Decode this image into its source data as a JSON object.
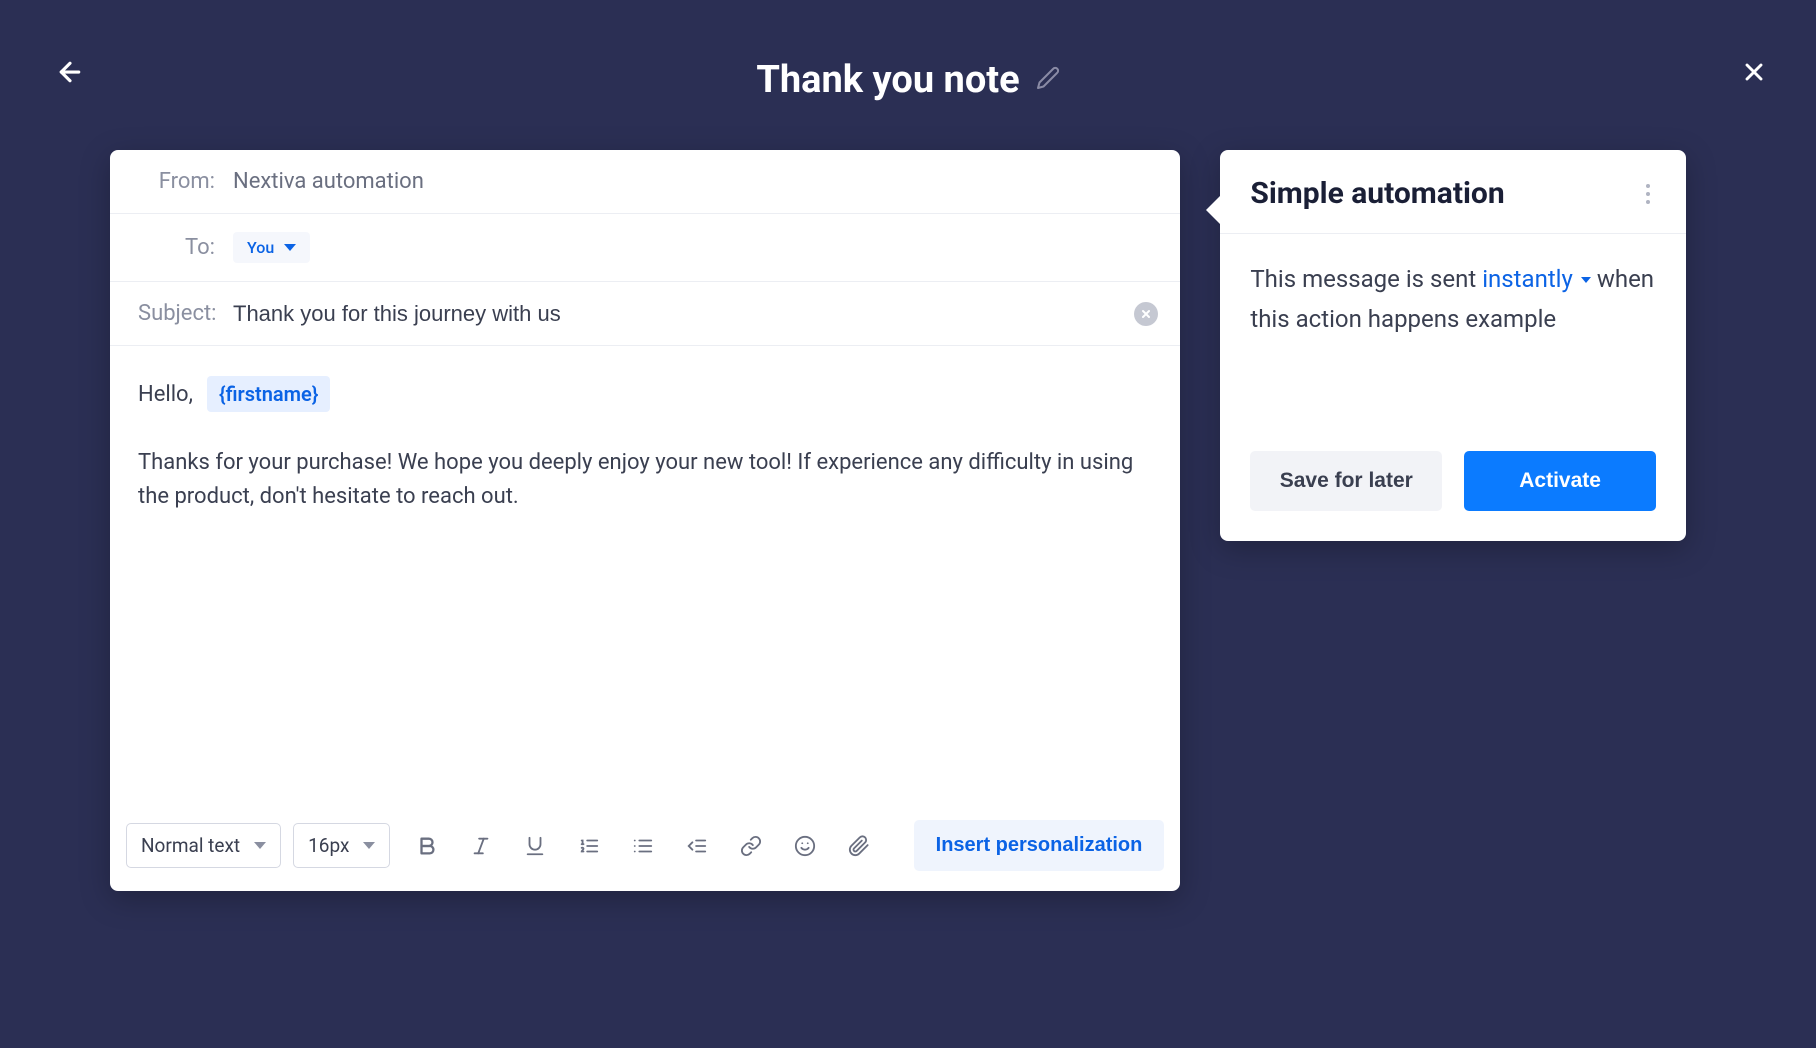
{
  "header": {
    "title": "Thank you note"
  },
  "email": {
    "from_label": "From:",
    "from_value": "Nextiva automation",
    "to_label": "To:",
    "to_value": "You",
    "subject_label": "Subject:",
    "subject_value": "Thank you for this journey with us",
    "greeting": "Hello,",
    "token": "{firstname}",
    "body": "Thanks for your purchase! We hope you deeply enjoy your new tool! If experience any difficulty in using the product, don't hesitate to reach out."
  },
  "toolbar": {
    "text_style": "Normal text",
    "font_size": "16px",
    "insert_personalization": "Insert personalization"
  },
  "sidebar": {
    "title": "Simple automation",
    "desc_prefix": "This message is sent",
    "timing": "instantly",
    "desc_suffix": "when this action happens example",
    "save_label": "Save for later",
    "activate_label": "Activate"
  }
}
